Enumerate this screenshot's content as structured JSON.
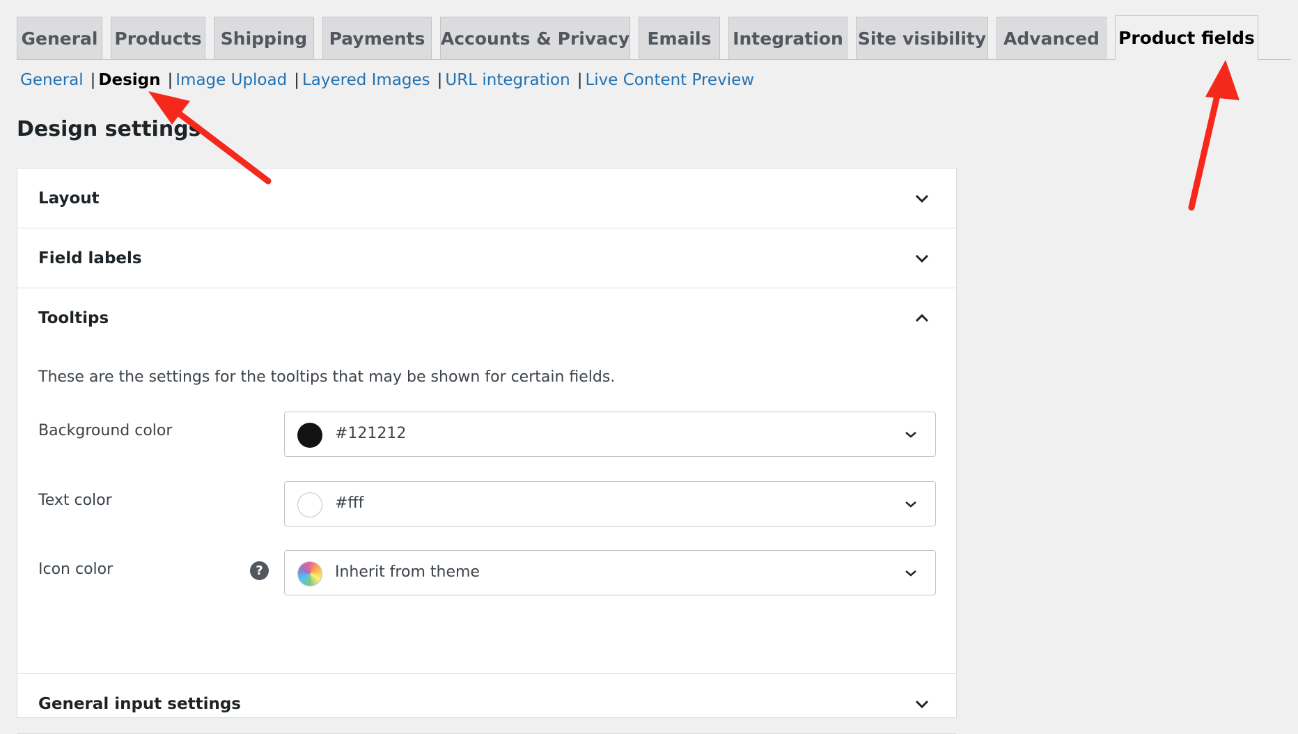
{
  "tabs": [
    {
      "label": "General",
      "active": false
    },
    {
      "label": "Products",
      "active": false
    },
    {
      "label": "Shipping",
      "active": false
    },
    {
      "label": "Payments",
      "active": false
    },
    {
      "label": "Accounts & Privacy",
      "active": false
    },
    {
      "label": "Emails",
      "active": false
    },
    {
      "label": "Integration",
      "active": false
    },
    {
      "label": "Site visibility",
      "active": false
    },
    {
      "label": "Advanced",
      "active": false
    },
    {
      "label": "Product fields",
      "active": true
    }
  ],
  "subnav": {
    "items": [
      {
        "label": "General",
        "current": false
      },
      {
        "label": "Design",
        "current": true
      },
      {
        "label": "Image Upload",
        "current": false
      },
      {
        "label": "Layered Images",
        "current": false
      },
      {
        "label": "URL integration",
        "current": false
      },
      {
        "label": "Live Content Preview",
        "current": false
      }
    ],
    "separator": "|"
  },
  "page": {
    "title": "Design settings"
  },
  "sections": {
    "layout": {
      "title": "Layout",
      "expanded": false
    },
    "field_labels": {
      "title": "Field labels",
      "expanded": false
    },
    "tooltips": {
      "title": "Tooltips",
      "expanded": true,
      "description": "These are the settings for the tooltips that may be shown for certain fields.",
      "background_color": {
        "label": "Background color",
        "value": "#121212",
        "swatch": "#121212"
      },
      "text_color": {
        "label": "Text color",
        "value": "#fff",
        "swatch": "#ffffff"
      },
      "icon_color": {
        "label": "Icon color",
        "value": "Inherit from theme",
        "swatch": "rainbow",
        "help": "?"
      }
    },
    "general_input": {
      "title": "General input settings",
      "expanded": false
    }
  },
  "icons": {
    "chevron_down": "chevron-down-icon",
    "chevron_up": "chevron-up-icon",
    "help": "help-icon"
  },
  "colors": {
    "link": "#2271b1",
    "annotation_arrow": "#f5281c",
    "tab_bg": "#dcdcde",
    "page_bg": "#f0f0f1"
  }
}
